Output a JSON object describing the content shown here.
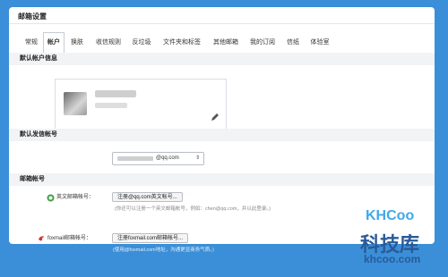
{
  "window": {
    "title": "邮箱设置"
  },
  "tabs": [
    {
      "label": "常规"
    },
    {
      "label": "帐户",
      "active": true
    },
    {
      "label": "换肤"
    },
    {
      "label": "收信规则"
    },
    {
      "label": "反垃圾"
    },
    {
      "label": "文件夹和标签"
    },
    {
      "label": "其他邮箱"
    },
    {
      "label": "我的订阅"
    },
    {
      "label": "信纸"
    },
    {
      "label": "体验室"
    }
  ],
  "sections": {
    "default_account": {
      "title": "默认帐户信息"
    },
    "default_sender": {
      "title": "默认发信帐号",
      "selected_suffix": "@qq.com"
    },
    "mailbox_accounts": {
      "title": "邮箱帐号"
    }
  },
  "accounts": {
    "english": {
      "label": "英文邮箱帐号：",
      "button": "注册@qq.com英文帐号...",
      "hint": "(你还可以注册一个英文邮箱帐号，例如：chen@qq.com，并以此登录。)"
    },
    "foxmail": {
      "label": "foxmail邮箱帐号：",
      "button": "注册foxmail.com邮箱帐号...",
      "hint": "(使用@foxmail.com地址，沟通更显商务气质。)"
    }
  },
  "watermark": {
    "logo": "KHCoo",
    "name": "科技库",
    "url": "khcoo.com"
  },
  "colors": {
    "background": "#3a8fd8",
    "accent": "#2a5a99",
    "foxmail_red": "#d9342b",
    "qq_green": "#43a047"
  }
}
